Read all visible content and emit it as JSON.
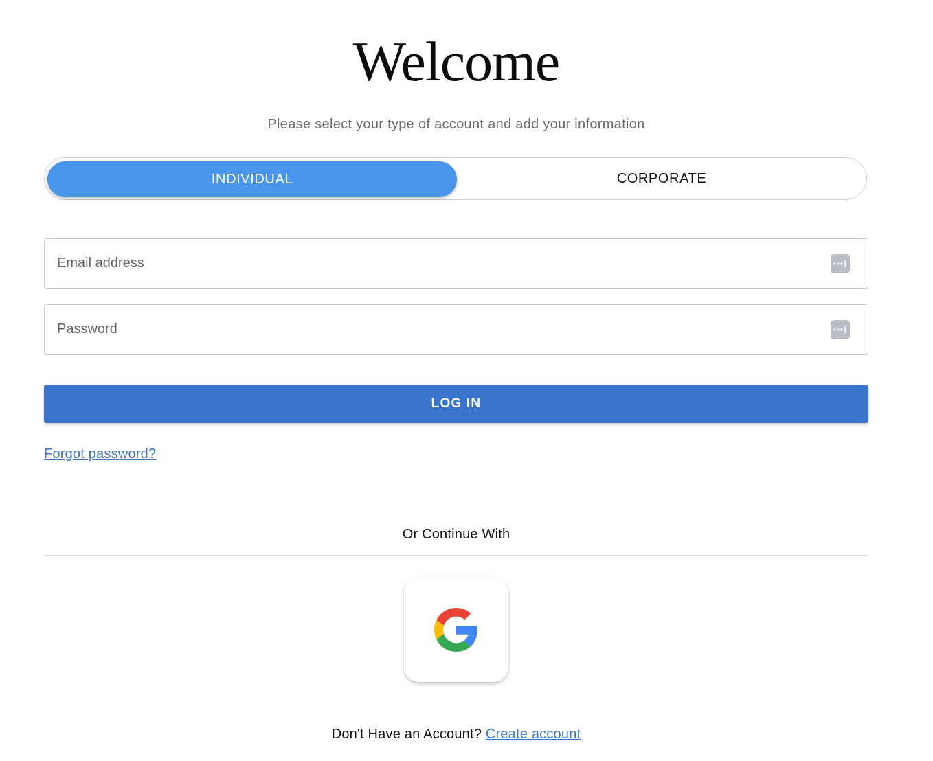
{
  "header": {
    "title": "Welcome",
    "subtitle": "Please select your type of account and add your information"
  },
  "account_type": {
    "options": [
      {
        "label": "INDIVIDUAL",
        "selected": true
      },
      {
        "label": "CORPORATE",
        "selected": false
      }
    ]
  },
  "form": {
    "email": {
      "placeholder": "Email address",
      "value": ""
    },
    "password": {
      "placeholder": "Password",
      "value": ""
    },
    "field_icon": "password-manager-icon",
    "login_label": "LOG IN",
    "forgot_label": "Forgot password?"
  },
  "social": {
    "label": "Or Continue With",
    "google_icon": "google-icon"
  },
  "footer": {
    "prompt": "Don't Have an Account?",
    "create_label": "Create account"
  },
  "colors": {
    "toggle_active": "#4a95ec",
    "primary": "#3a75cd",
    "text": "#111111",
    "muted": "#6b6b6b",
    "google_red": "#db4437",
    "google_yellow": "#f4b400",
    "google_green": "#0f9d58",
    "google_blue": "#4285f4"
  }
}
